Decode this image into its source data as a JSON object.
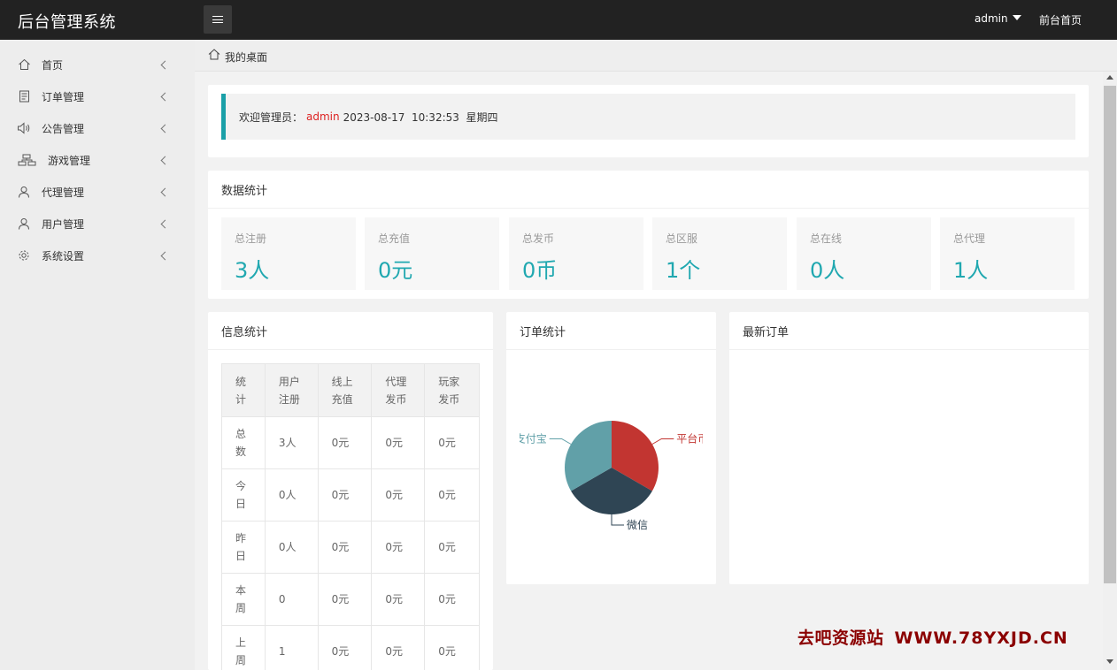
{
  "header": {
    "brand": "后台管理系统",
    "user": "admin",
    "front_link": "前台首页"
  },
  "sidebar": {
    "items": [
      {
        "label": "首页",
        "icon": "home-icon"
      },
      {
        "label": "订单管理",
        "icon": "document-icon"
      },
      {
        "label": "公告管理",
        "icon": "speaker-icon"
      },
      {
        "label": "游戏管理",
        "icon": "sitemap-icon"
      },
      {
        "label": "代理管理",
        "icon": "agent-icon"
      },
      {
        "label": "用户管理",
        "icon": "user-icon"
      },
      {
        "label": "系统设置",
        "icon": "gear-icon"
      }
    ]
  },
  "breadcrumb": {
    "label": "我的桌面"
  },
  "welcome": {
    "prefix": "欢迎管理员：",
    "admin": "admin",
    "datetime": "2023-08-17  10:32:53  星期四"
  },
  "stats": {
    "title": "数据统计",
    "items": [
      {
        "label": "总注册",
        "value": "3人"
      },
      {
        "label": "总充值",
        "value": "0元"
      },
      {
        "label": "总发币",
        "value": "0币"
      },
      {
        "label": "总区服",
        "value": "1个"
      },
      {
        "label": "总在线",
        "value": "0人"
      },
      {
        "label": "总代理",
        "value": "1人"
      }
    ]
  },
  "info": {
    "title": "信息统计",
    "headers": [
      "统\n计",
      "用户\n注册",
      "线上\n充值",
      "代理\n发币",
      "玩家\n发币"
    ],
    "rows": [
      [
        "总\n数",
        "3人",
        "0元",
        "0元",
        "0元"
      ],
      [
        "今\n日",
        "0人",
        "0元",
        "0元",
        "0元"
      ],
      [
        "昨\n日",
        "0人",
        "0元",
        "0元",
        "0元"
      ],
      [
        "本\n周",
        "0",
        "0元",
        "0元",
        "0元"
      ],
      [
        "上\n周",
        "1",
        "0元",
        "0元",
        "0元"
      ]
    ]
  },
  "orders_chart": {
    "title": "订单统计"
  },
  "latest_orders": {
    "title": "最新订单"
  },
  "chart_data": {
    "type": "pie",
    "title": "",
    "categories": [
      "平台币",
      "微信",
      "支付宝"
    ],
    "values": [
      1,
      1,
      1
    ],
    "colors": [
      "#c23531",
      "#2f4554",
      "#61a0a8"
    ],
    "visible_labels": [
      "平台币",
      "微信",
      "支付宝"
    ]
  },
  "watermark": {
    "text": "去吧资源站",
    "url": "WWW.78YXJD.CN"
  },
  "colors": {
    "accent": "#1aa0a8",
    "topbar": "#222222",
    "admin_highlight": "#dd2222"
  }
}
